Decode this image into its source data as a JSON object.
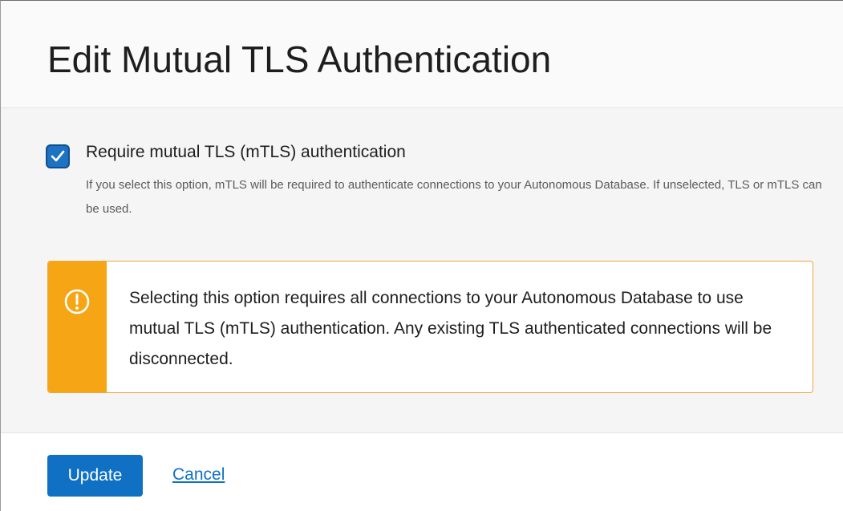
{
  "dialog": {
    "title": "Edit Mutual TLS Authentication"
  },
  "mtls_option": {
    "checked": true,
    "label": "Require mutual TLS (mTLS) authentication",
    "help": "If you select this option, mTLS will be required to authenticate connections to your Autonomous Database. If unselected, TLS or mTLS can be used."
  },
  "warning": {
    "icon": "exclamation-circle-icon",
    "text": "Selecting this option requires all connections to your Autonomous Database to use mutual TLS (mTLS) authentication. Any existing TLS authenticated connections will be disconnected.",
    "stripe_color": "#f6a515",
    "border_color": "#f2a53a"
  },
  "footer": {
    "update_label": "Update",
    "cancel_label": "Cancel"
  },
  "colors": {
    "primary": "#1070c4",
    "checkbox_fill": "#1e72c2"
  }
}
